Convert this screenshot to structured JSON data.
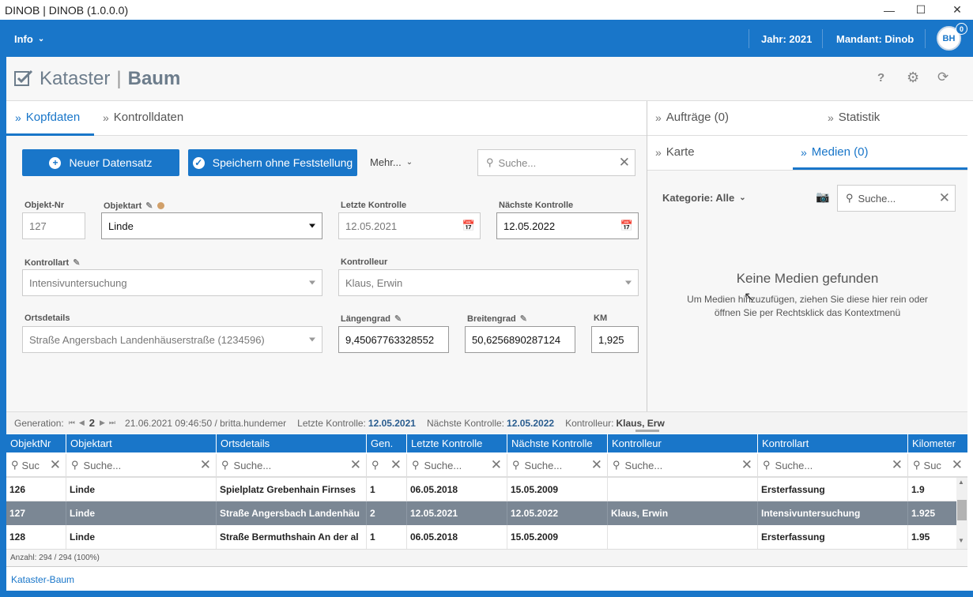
{
  "window": {
    "title": "DINOB | DINOB (1.0.0.0)"
  },
  "topnav": {
    "info": "Info",
    "year": "Jahr: 2021",
    "client": "Mandant: Dinob",
    "avatar": "BH",
    "badge": "0"
  },
  "app": {
    "title_part1": "Kataster",
    "title_part2": "Baum"
  },
  "tabs_left": [
    {
      "label": "Kopfdaten"
    },
    {
      "label": "Kontrolldaten"
    }
  ],
  "tabs_right": {
    "row1": [
      {
        "label": "Aufträge (0)"
      },
      {
        "label": "Statistik"
      }
    ],
    "row2": [
      {
        "label": "Karte"
      },
      {
        "label": "Medien (0)"
      }
    ]
  },
  "toolbar": {
    "new": "Neuer Datensatz",
    "save": "Speichern ohne Feststellung",
    "more": "Mehr...",
    "search_placeholder": "Suche..."
  },
  "form": {
    "objekt_nr": {
      "label": "Objekt-Nr",
      "value": "127"
    },
    "objektart": {
      "label": "Objektart",
      "value": "Linde"
    },
    "letzte": {
      "label": "Letzte Kontrolle",
      "value": "12.05.2021"
    },
    "naechste": {
      "label": "Nächste Kontrolle",
      "value": "12.05.2022"
    },
    "kontrollart": {
      "label": "Kontrollart",
      "value": "Intensivuntersuchung"
    },
    "kontrolleur": {
      "label": "Kontrolleur",
      "value": "Klaus, Erwin"
    },
    "ortsdetails": {
      "label": "Ortsdetails",
      "value": "Straße Angersbach  Landenhäuserstraße (1234596)"
    },
    "laengengrad": {
      "label": "Längengrad",
      "value": "9,45067763328552"
    },
    "breitengrad": {
      "label": "Breitengrad",
      "value": "50,6256890287124"
    },
    "km": {
      "label": "KM",
      "value": "1,925"
    }
  },
  "media": {
    "category": "Kategorie: Alle",
    "search_placeholder": "Suche...",
    "empty_title": "Keine Medien gefunden",
    "empty_line1": "Um Medien hinzuzufügen, ziehen Sie diese hier rein oder",
    "empty_line2": "öffnen Sie per Rechtsklick das Kontextmenü"
  },
  "status": {
    "gen_label": "Generation:",
    "gen_value": "2",
    "timestamp": "21.06.2021 09:46:50 / britta.hundemer",
    "letzte_label": "Letzte Kontrolle:",
    "letzte_value": "12.05.2021",
    "naechste_label": "Nächste Kontrolle:",
    "naechste_value": "12.05.2022",
    "kontrolleur_label": "Kontrolleur:",
    "kontrolleur_value": "Klaus, Erw"
  },
  "table": {
    "columns": [
      "ObjektNr",
      "Objektart",
      "Ortsdetails",
      "Gen.",
      "Letzte Kontrolle",
      "Nächste Kontrolle",
      "Kontrolleur",
      "Kontrollart",
      "Kilometer"
    ],
    "filters": [
      "Suc",
      "Suche...",
      "Suche...",
      "",
      "Suche...",
      "Suche...",
      "Suche...",
      "Suche...",
      "Suc"
    ],
    "rows": [
      [
        "126",
        "Linde",
        "Spielplatz Grebenhain  Firnses",
        "1",
        "06.05.2018",
        "15.05.2009",
        "",
        "Ersterfassung",
        "1.9"
      ],
      [
        "127",
        "Linde",
        "Straße Angersbach  Landenhäu",
        "2",
        "12.05.2021",
        "12.05.2022",
        "Klaus, Erwin",
        "Intensivuntersuchung",
        "1.925"
      ],
      [
        "128",
        "Linde",
        "Straße Bermuthshain  An der al",
        "1",
        "06.05.2018",
        "15.05.2009",
        "",
        "Ersterfassung",
        "1.95"
      ]
    ],
    "count": "Anzahl: 294 / 294 (100%)"
  },
  "footer": {
    "tab": "Kataster-Baum"
  }
}
